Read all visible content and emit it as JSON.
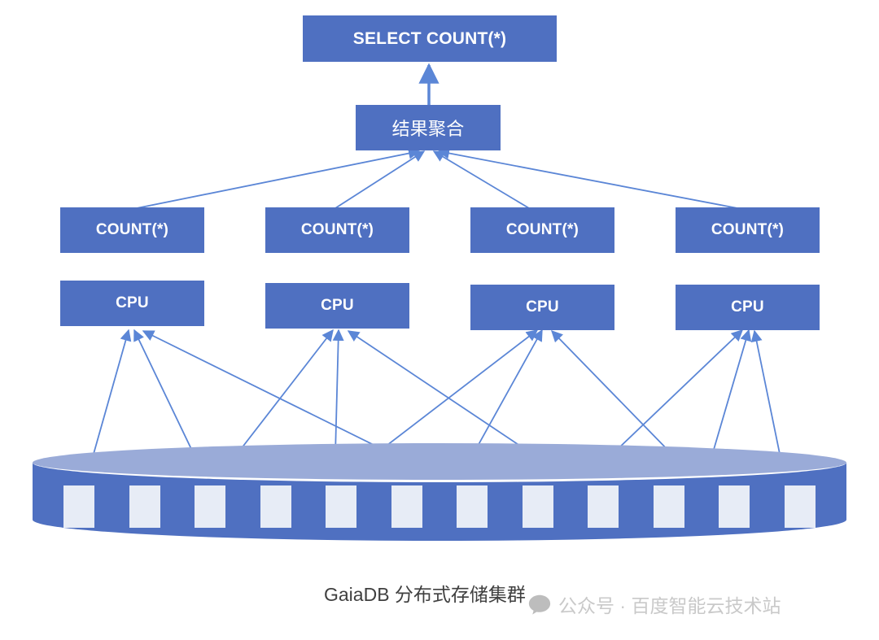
{
  "diagram": {
    "title_node": {
      "label": "SELECT COUNT(*)"
    },
    "aggregate_node": {
      "label": "结果聚合"
    },
    "count_nodes": [
      {
        "label": "COUNT(*)"
      },
      {
        "label": "COUNT(*)"
      },
      {
        "label": "COUNT(*)"
      },
      {
        "label": "COUNT(*)"
      }
    ],
    "cpu_nodes": [
      {
        "label": "CPU"
      },
      {
        "label": "CPU"
      },
      {
        "label": "CPU"
      },
      {
        "label": "CPU"
      }
    ],
    "storage": {
      "block_count": 12,
      "caption": "GaiaDB 分布式存储集群"
    },
    "watermark": {
      "icon": "speech-bubble-icon",
      "text": "公众号 · 百度智能云技术站"
    },
    "colors": {
      "node_fill": "#4f70c1",
      "node_text": "#ffffff",
      "cylinder_body": "#4f70c1",
      "cylinder_top": "#9aabd8",
      "data_block": "#e7ecf6",
      "edge_line": "#5b86d6",
      "caption_text": "#3f3f3f",
      "watermark_text": "#c9c9c9",
      "background": "#ffffff"
    }
  }
}
